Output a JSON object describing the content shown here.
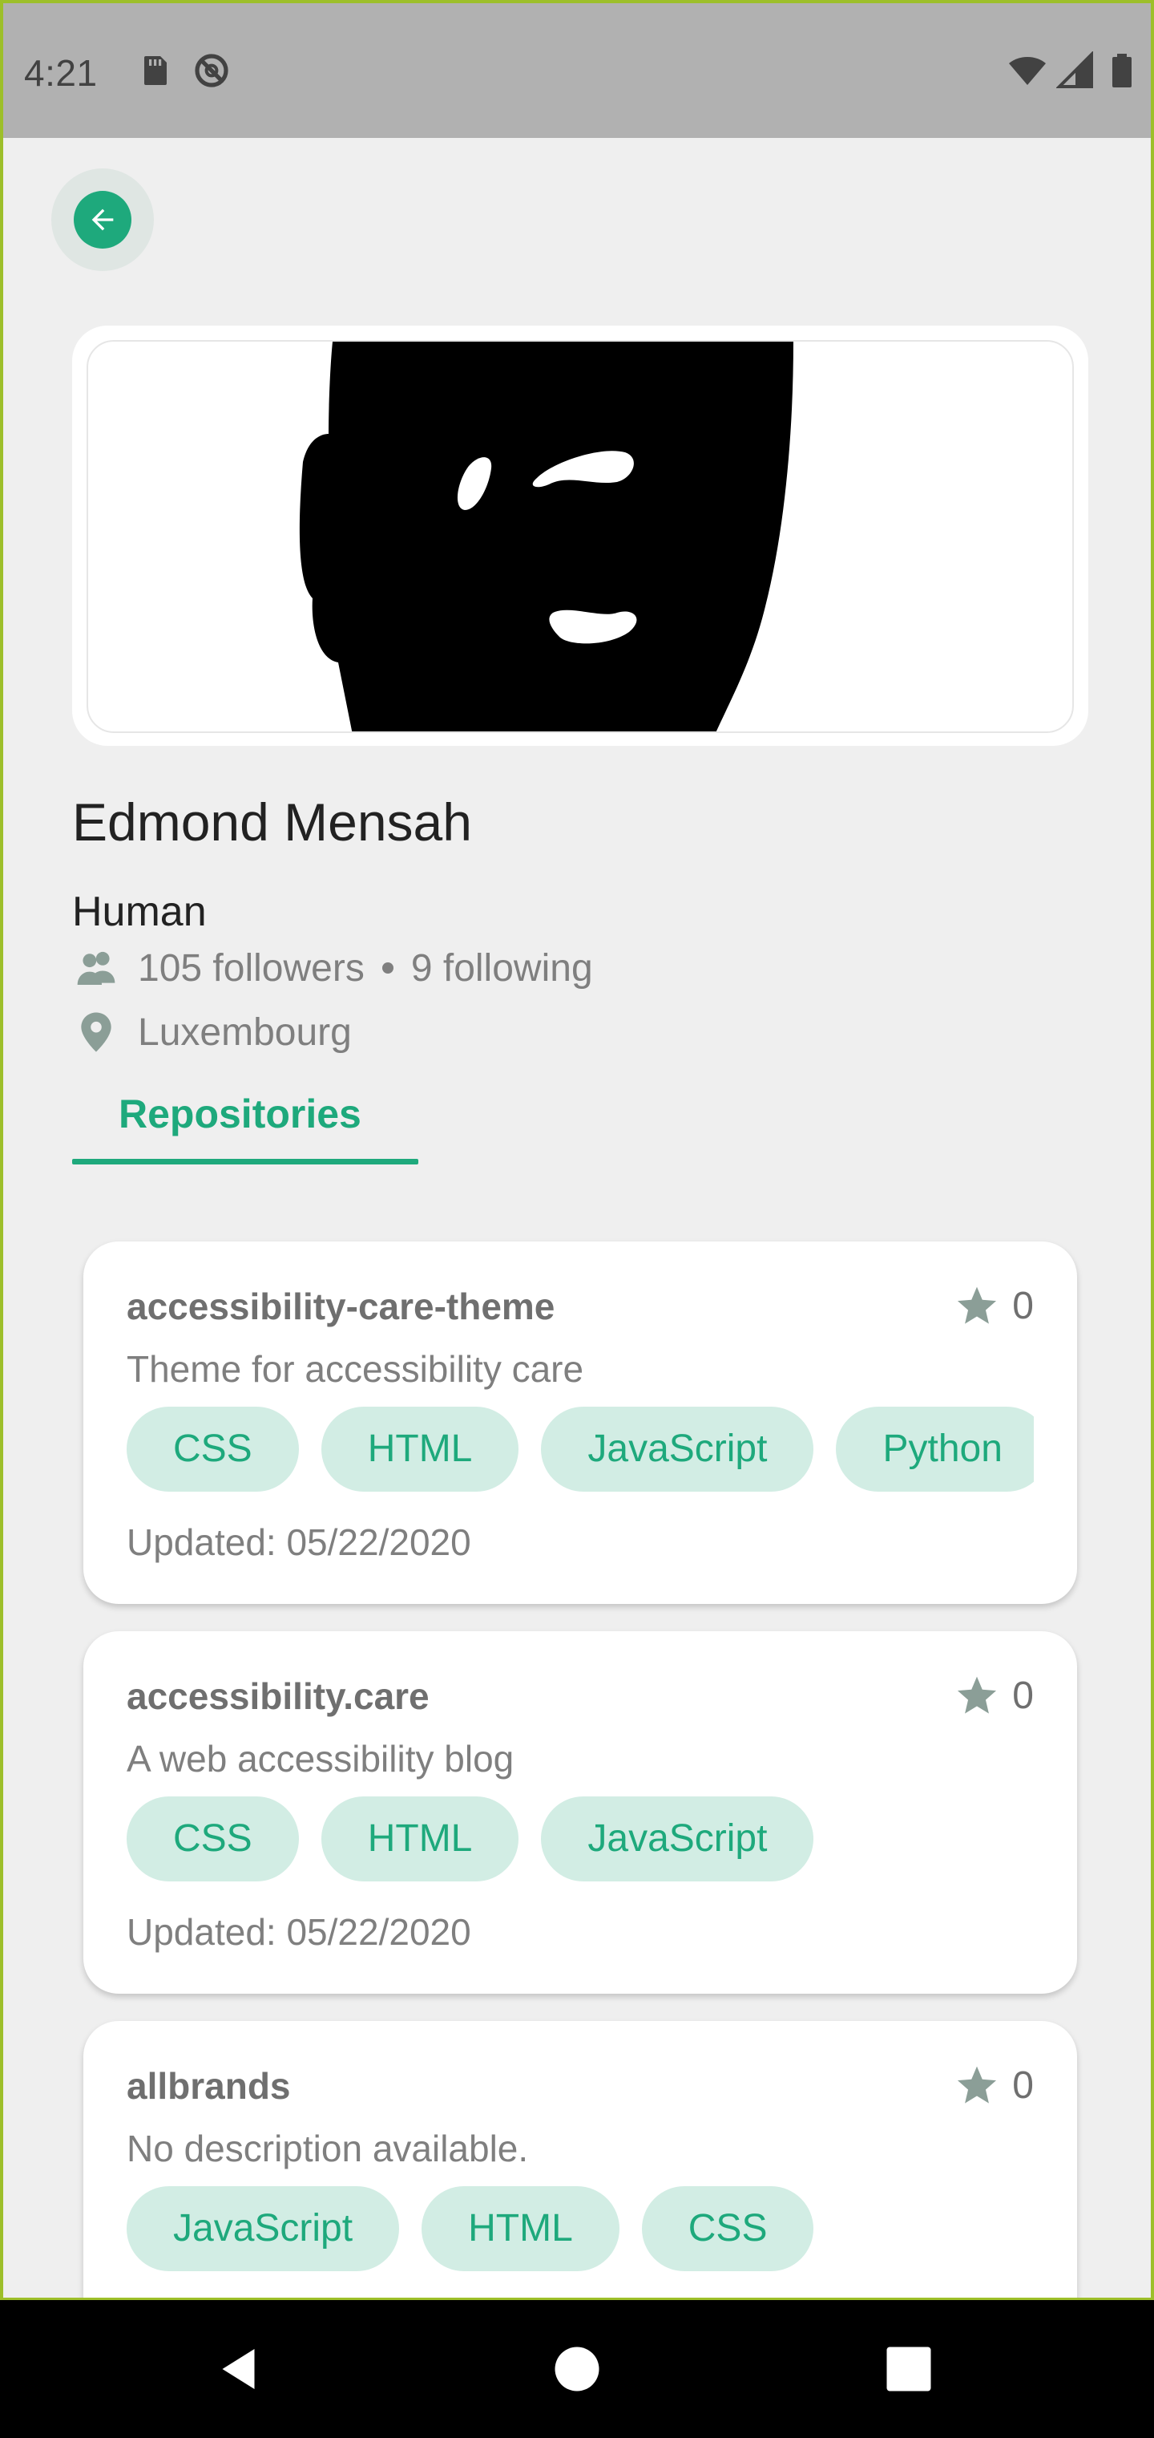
{
  "status_bar": {
    "time": "4:21",
    "icons": [
      "sd-card-icon",
      "do-not-disturb-icon",
      "wifi-icon",
      "signal-icon",
      "battery-icon"
    ]
  },
  "colors": {
    "accent": "#1ea97c",
    "chip_bg": "#d2ede4",
    "screen_bg": "#efefef",
    "status_bar_bg": "#b1b1b1",
    "meta_icon": "#8b9e97"
  },
  "profile": {
    "name": "Edmond Mensah",
    "bio": "Human",
    "followers": "105 followers",
    "following": "9 following",
    "location": "Luxembourg"
  },
  "tabs": [
    {
      "label": "Repositories",
      "selected": true
    }
  ],
  "repositories": [
    {
      "name": "accessibility-care-theme",
      "stars": "0",
      "description": "Theme for accessibility care",
      "languages": [
        "CSS",
        "HTML",
        "JavaScript",
        "Python"
      ],
      "updated": "Updated: 05/22/2020"
    },
    {
      "name": "accessibility.care",
      "stars": "0",
      "description": "A web accessibility blog",
      "languages": [
        "CSS",
        "HTML",
        "JavaScript"
      ],
      "updated": "Updated: 05/22/2020"
    },
    {
      "name": "allbrands",
      "stars": "0",
      "description": "No description available.",
      "languages": [
        "JavaScript",
        "HTML",
        "CSS"
      ],
      "updated": ""
    }
  ],
  "nav_bar": {
    "buttons": [
      "back-nav-icon",
      "home-nav-icon",
      "recents-nav-icon"
    ]
  }
}
